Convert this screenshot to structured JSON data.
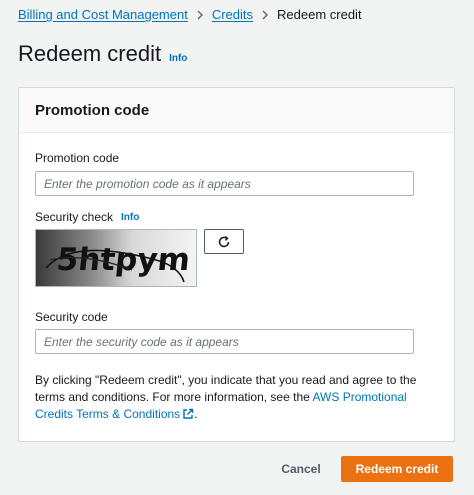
{
  "breadcrumb": {
    "items": [
      "Billing and Cost Management",
      "Credits"
    ],
    "current": "Redeem credit"
  },
  "header": {
    "title": "Redeem credit",
    "info": "Info"
  },
  "card": {
    "title": "Promotion code",
    "promo_label": "Promotion code",
    "promo_placeholder": "Enter the promotion code as it appears",
    "security_label": "Security check",
    "security_info": "Info",
    "captcha_text": "5htpym",
    "code_label": "Security code",
    "code_placeholder": "Enter the security code as it appears",
    "terms_text": "By clicking \"Redeem credit\", you indicate that you read and agree to the terms and conditions. For more information, see the ",
    "terms_link": "AWS Promotional Credits Terms & Conditions",
    "terms_end": "."
  },
  "footer": {
    "cancel": "Cancel",
    "redeem": "Redeem credit"
  },
  "icons": {
    "refresh": "refresh-icon",
    "external": "external-link-icon",
    "chevron": "chevron-right-icon"
  },
  "colors": {
    "link": "#0073bb",
    "primary": "#ec7211",
    "background": "#f2f3f3"
  }
}
